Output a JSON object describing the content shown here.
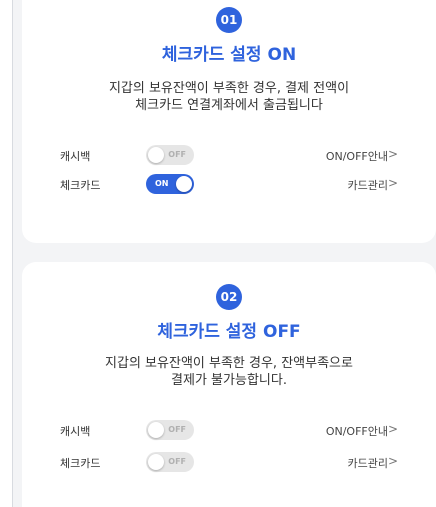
{
  "colors": {
    "accent": "#2f63dd",
    "toggle_off": "#e6e6e6",
    "background": "#f3f4f6"
  },
  "cards": [
    {
      "step": "01",
      "title": "체크카드 설정 ON",
      "desc_line1": "지갑의 보유잔액이 부족한 경우, 결제 전액이",
      "desc_line2": "체크카드 연결계좌에서 출금됩니다",
      "rows": [
        {
          "label": "캐시백",
          "toggle_state": "off",
          "toggle_text": "OFF",
          "link": "ON/OFF안내",
          "chevron": ">"
        },
        {
          "label": "체크카드",
          "toggle_state": "on",
          "toggle_text": "ON",
          "link": "카드관리",
          "chevron": ">"
        }
      ]
    },
    {
      "step": "02",
      "title": "체크카드 설정 OFF",
      "desc_line1": "지갑의 보유잔액이 부족한 경우, 잔액부족으로",
      "desc_line2": "결제가 불가능합니다.",
      "rows": [
        {
          "label": "캐시백",
          "toggle_state": "off",
          "toggle_text": "OFF",
          "link": "ON/OFF안내",
          "chevron": ">"
        },
        {
          "label": "체크카드",
          "toggle_state": "off",
          "toggle_text": "OFF",
          "link": "카드관리",
          "chevron": ">"
        }
      ]
    }
  ]
}
